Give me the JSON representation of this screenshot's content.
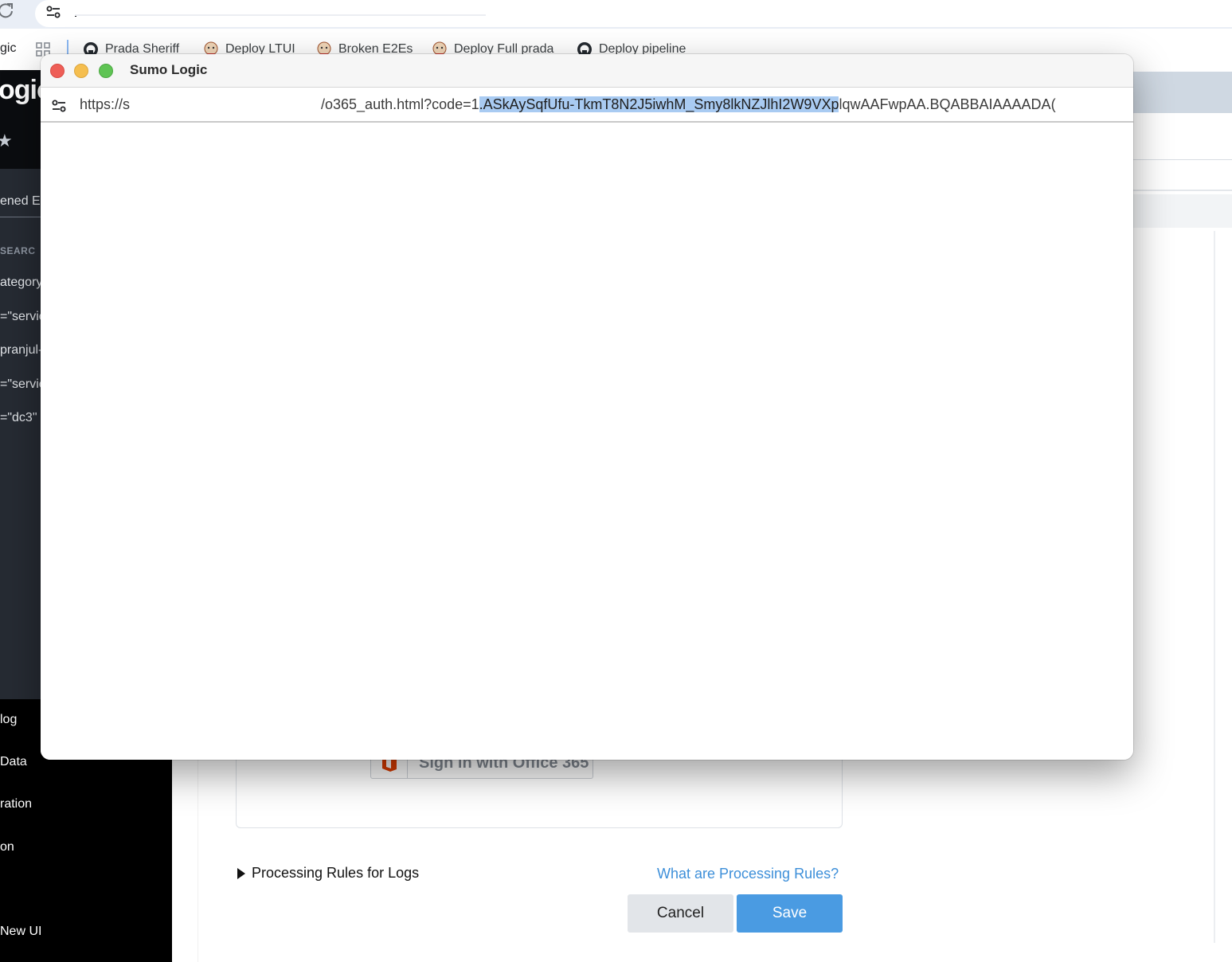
{
  "browser": {
    "tab_fragment": "gic",
    "bookmarks": [
      {
        "label": "Prada Sheriff",
        "icon": "github-icon"
      },
      {
        "label": "Deploy LTUI",
        "icon": "jenkins-icon"
      },
      {
        "label": "Broken E2Es",
        "icon": "jenkins-icon"
      },
      {
        "label": "Deploy Full prada",
        "icon": "jenkins-icon"
      },
      {
        "label": "Deploy pipeline",
        "icon": "github-icon"
      }
    ]
  },
  "app": {
    "logo_fragment": "ogic",
    "nav_tab_fragment": "ened E",
    "nav_section": "SEARC",
    "nav_query_fragments": [
      "ategory=",
      "=\"servic",
      "pranjul-",
      "=\"servic",
      "=\"dc3\""
    ],
    "nav_bottom_items": [
      "log",
      "Data",
      "ration",
      "on",
      "New UI"
    ],
    "signin_button": "Sign in with Office 365",
    "processing_rules_label": "Processing Rules for Logs",
    "processing_rules_link": "What are Processing Rules?",
    "cancel_label": "Cancel",
    "save_label": "Save",
    "colors": {
      "save": "#4a9be2",
      "link": "#3d8fd9",
      "office": "#d83b01"
    }
  },
  "popup": {
    "title": "Sumo Logic",
    "url_scheme": "https://s",
    "url_before_selection": "/o365_auth.html?code=1",
    "url_selected": ".ASkAySqfUfu-TkmT8N2J5iwhM_Smy8lkNZJlhI2W9VXp",
    "url_after_selection": "lqwAAFwpAA.BQABBAIAAAADA("
  }
}
